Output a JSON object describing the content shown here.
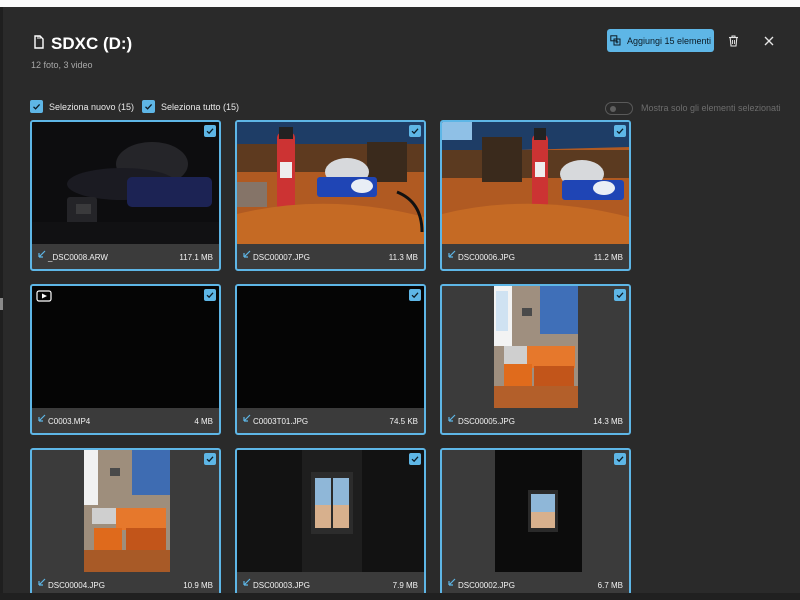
{
  "header": {
    "title": "SDXC (D:)",
    "subtitle": "12 foto, 3 video",
    "add_button_label": "Aggiungi 15 elementi"
  },
  "selection": {
    "select_new_label": "Seleziona nuovo (15)",
    "select_all_label": "Seleziona tutto (15)",
    "show_selected_label": "Mostra solo gli elementi selezionati",
    "show_selected_on": false
  },
  "items": [
    {
      "name": "_DSC0008.ARW",
      "size": "117.1 MB",
      "selected": true
    },
    {
      "name": "DSC00007.JPG",
      "size": "11.3 MB",
      "selected": true
    },
    {
      "name": "DSC00006.JPG",
      "size": "11.2 MB",
      "selected": true
    },
    {
      "name": "C0003.MP4",
      "size": "4 MB",
      "selected": true
    },
    {
      "name": "C0003T01.JPG",
      "size": "74.5 KB",
      "selected": true
    },
    {
      "name": "DSC00005.JPG",
      "size": "14.3 MB",
      "selected": true
    },
    {
      "name": "DSC00004.JPG",
      "size": "10.9 MB",
      "selected": true
    },
    {
      "name": "DSC00003.JPG",
      "size": "7.9 MB",
      "selected": true
    },
    {
      "name": "DSC00002.JPG",
      "size": "6.7 MB",
      "selected": true
    }
  ],
  "colors": {
    "accent": "#5eb6e6",
    "background": "#2a2a2a",
    "tile_footer": "#3b3b3b"
  }
}
